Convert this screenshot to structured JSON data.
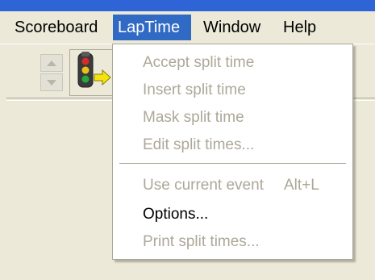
{
  "menubar": {
    "items": [
      {
        "label": "Scoreboard"
      },
      {
        "label": "LapTime",
        "active": true
      },
      {
        "label": "Window"
      },
      {
        "label": "Help"
      }
    ]
  },
  "toolbar": {
    "icons": [
      "spin-up-icon",
      "spin-down-icon",
      "traffic-light-icon"
    ]
  },
  "laptime_menu": {
    "items": [
      {
        "label": "Accept split time",
        "enabled": false
      },
      {
        "label": "Insert split time",
        "enabled": false
      },
      {
        "label": "Mask split time",
        "enabled": false
      },
      {
        "label": "Edit split times...",
        "enabled": false
      },
      {
        "label": "Use current event",
        "shortcut": "Alt+L",
        "enabled": false
      },
      {
        "label": "Options...",
        "enabled": true
      },
      {
        "label": "Print split times...",
        "enabled": false
      }
    ]
  },
  "colors": {
    "menu_highlight": "#316ac5",
    "disabled_text": "#aca899",
    "title_bar": "#2f64d6",
    "background": "#ece9d8"
  }
}
